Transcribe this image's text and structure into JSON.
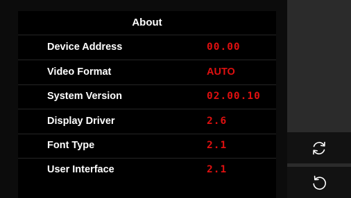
{
  "panel": {
    "title": "About",
    "rows": [
      {
        "label": "Device Address",
        "value": "00.00"
      },
      {
        "label": "Video Format",
        "value": "AUTO"
      },
      {
        "label": "System Version",
        "value": "02.00.10"
      },
      {
        "label": "Display Driver",
        "value": "2.6"
      },
      {
        "label": "Font Type",
        "value": "2.1"
      },
      {
        "label": "User Interface",
        "value": "2.1"
      }
    ]
  },
  "sidebar": {
    "buttons": [
      {
        "icon": "refresh-icon"
      },
      {
        "icon": "back-icon"
      }
    ]
  },
  "colors": {
    "value_red": "#e01010",
    "label_white": "#ffffff",
    "panel_bg": "#000000",
    "sidebar_bg": "#2b2b2b"
  }
}
